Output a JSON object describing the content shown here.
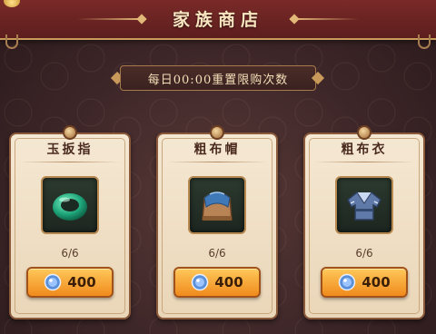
{
  "header": {
    "title": "家族商店"
  },
  "banner": {
    "text": "每日00:00重置限购次数"
  },
  "shop_items": [
    {
      "name": "玉扳指",
      "icon": "jade-ring-icon",
      "stock": "6/6",
      "price": "400",
      "currency_icon": "gem-currency-icon"
    },
    {
      "name": "粗布帽",
      "icon": "cloth-hat-icon",
      "stock": "6/6",
      "price": "400",
      "currency_icon": "gem-currency-icon"
    },
    {
      "name": "粗布衣",
      "icon": "cloth-robe-icon",
      "stock": "6/6",
      "price": "400",
      "currency_icon": "gem-currency-icon"
    }
  ],
  "colors": {
    "title_bar": "#6a2423",
    "card_bg": "#f2e4cc",
    "button": "#f5a534",
    "gold_trim": "#c89a5c"
  }
}
